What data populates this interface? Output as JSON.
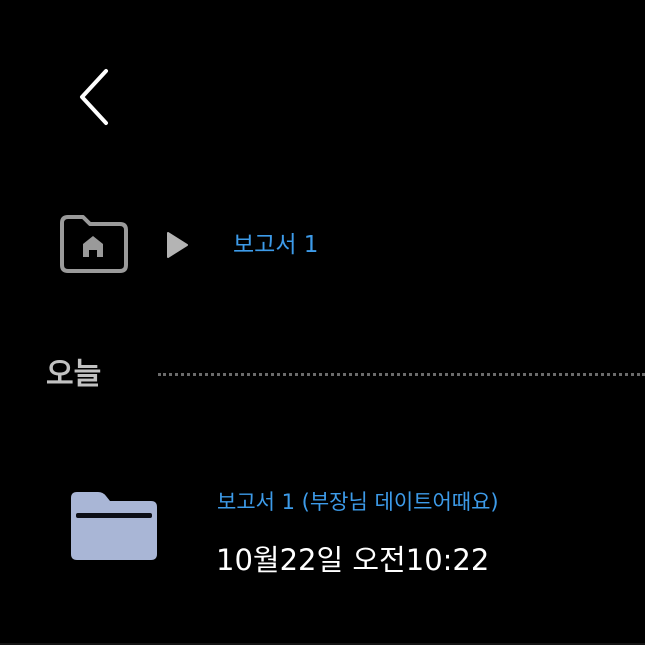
{
  "navigation": {
    "back_icon": "chevron-left-icon",
    "home_icon": "home-folder-icon",
    "separator_icon": "play-triangle-icon",
    "current_folder": "보고서 1"
  },
  "section": {
    "label": "오늘"
  },
  "files": [
    {
      "name": "보고서 1 (부장님 데이트어때요)",
      "modified": "10월22일 오전10:22",
      "icon": "folder-icon"
    }
  ],
  "colors": {
    "background": "#000000",
    "accent_link": "#3d9be9",
    "section_label": "#c2c2c2",
    "folder": "#a9b6d6",
    "icon_gray": "#9a9a9a"
  }
}
